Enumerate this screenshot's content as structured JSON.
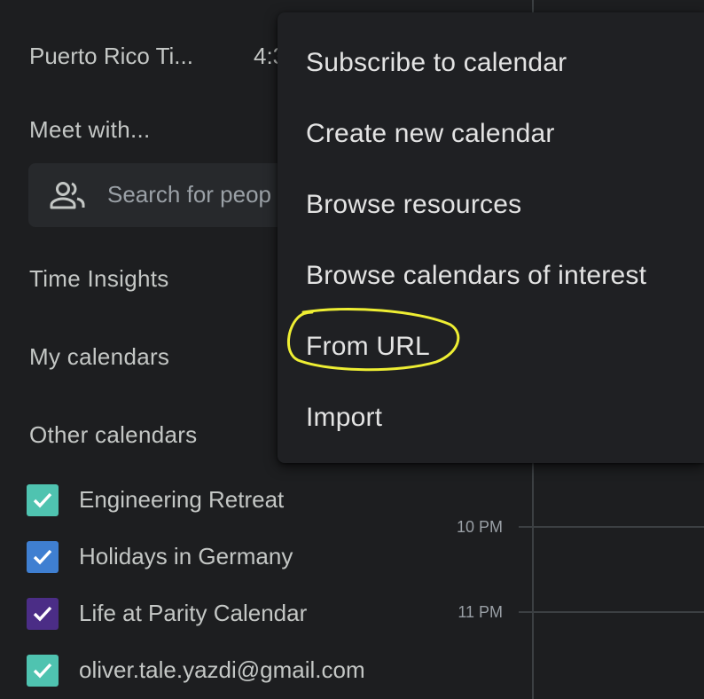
{
  "sidebar": {
    "timezone": {
      "name": "Puerto Rico Ti...",
      "time": "4:3"
    },
    "meet_with": {
      "heading": "Meet with...",
      "search_placeholder": "Search for peop",
      "icon": "people-icon"
    },
    "time_insights": "Time Insights",
    "my_calendars": "My calendars",
    "other_calendars": {
      "heading": "Other calendars",
      "items": [
        {
          "label": "Engineering Retreat",
          "color": "#4fc3b0",
          "checked": true
        },
        {
          "label": "Holidays in Germany",
          "color": "#3f7fd1",
          "checked": true
        },
        {
          "label": "Life at Parity Calendar",
          "color": "#4b2d86",
          "checked": true
        },
        {
          "label": "oliver.tale.yazdi@gmail.com",
          "color": "#4fc3b0",
          "checked": true
        }
      ]
    }
  },
  "time_grid": {
    "hours": [
      "10 PM",
      "11 PM"
    ]
  },
  "menu": {
    "items": [
      {
        "label": "Subscribe to calendar"
      },
      {
        "label": "Create new calendar"
      },
      {
        "label": "Browse resources"
      },
      {
        "label": "Browse calendars of interest"
      },
      {
        "label": "From URL",
        "highlighted": true
      },
      {
        "label": "Import"
      }
    ]
  },
  "colors": {
    "background": "#1d1e20",
    "menu_background": "#1f2023",
    "highlight": "#eeee33"
  }
}
